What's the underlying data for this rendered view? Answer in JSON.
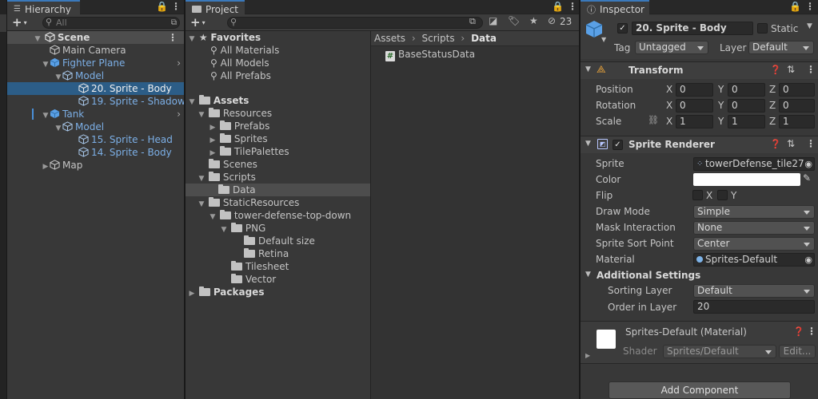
{
  "hierarchy": {
    "tab": "Hierarchy",
    "search_placeholder": "All",
    "scene": "Scene",
    "main_camera": "Main Camera",
    "fighter_plane": "Fighter Plane",
    "model1": "Model",
    "sprite_body": "20. Sprite - Body",
    "sprite_shadow": "19. Sprite - Shadow",
    "tank": "Tank",
    "model2": "Model",
    "sprite_head": "15. Sprite - Head",
    "sprite_body2": "14. Sprite - Body",
    "map": "Map"
  },
  "project": {
    "tab": "Project",
    "hidden_count": "23",
    "favorites": "Favorites",
    "all_materials": "All Materials",
    "all_models": "All Models",
    "all_prefabs": "All Prefabs",
    "assets": "Assets",
    "resources": "Resources",
    "prefabs": "Prefabs",
    "sprites": "Sprites",
    "tilepalettes": "TilePalettes",
    "scenes": "Scenes",
    "scripts": "Scripts",
    "data": "Data",
    "static_resources": "StaticResources",
    "tower_defense": "tower-defense-top-down",
    "png": "PNG",
    "default_size": "Default size",
    "retina": "Retina",
    "tilesheet": "Tilesheet",
    "vector": "Vector",
    "packages": "Packages",
    "breadcrumb": [
      "Assets",
      "Scripts",
      "Data"
    ],
    "file": "BaseStatusData",
    "file_icon": "#"
  },
  "inspector": {
    "tab": "Inspector",
    "object_name": "20. Sprite - Body",
    "static_label": "Static",
    "tag_label": "Tag",
    "tag_value": "Untagged",
    "layer_label": "Layer",
    "layer_value": "Default",
    "transform": {
      "title": "Transform",
      "position_label": "Position",
      "rotation_label": "Rotation",
      "scale_label": "Scale",
      "x": "X",
      "y": "Y",
      "z": "Z",
      "position": [
        "0",
        "0",
        "0"
      ],
      "rotation": [
        "0",
        "0",
        "0"
      ],
      "scale": [
        "1",
        "1",
        "1"
      ]
    },
    "sprite_renderer": {
      "title": "Sprite Renderer",
      "sprite_label": "Sprite",
      "sprite_value": "towerDefense_tile27(",
      "color_label": "Color",
      "flip_label": "Flip",
      "flip_x": "X",
      "flip_y": "Y",
      "draw_mode_label": "Draw Mode",
      "draw_mode_value": "Simple",
      "mask_label": "Mask Interaction",
      "mask_value": "None",
      "sort_point_label": "Sprite Sort Point",
      "sort_point_value": "Center",
      "material_label": "Material",
      "material_value": "Sprites-Default",
      "additional": "Additional Settings",
      "sorting_layer_label": "Sorting Layer",
      "sorting_layer_value": "Default",
      "order_label": "Order in Layer",
      "order_value": "20"
    },
    "material": {
      "title": "Sprites-Default (Material)",
      "shader_label": "Shader",
      "shader_value": "Sprites/Default",
      "edit": "Edit..."
    },
    "add_component": "Add Component"
  },
  "colors": {
    "selection": "#2c5d87",
    "accent_blue": "#7cafe6",
    "tab_accent": "#3a79bb"
  }
}
